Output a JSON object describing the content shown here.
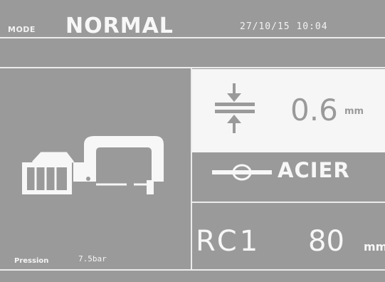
{
  "header": {
    "mode_label": "MODE",
    "mode_value": "NORMAL",
    "datetime": "27/10/15 10:04"
  },
  "thickness": {
    "icon": "sheet-thickness-icon",
    "value": "0.6",
    "unit": "mm"
  },
  "material": {
    "icon": "sheet-material-icon",
    "name": "ACIER"
  },
  "arm": {
    "label": "RC1",
    "value": "80",
    "unit": "mm"
  },
  "pression": {
    "label": "Pression",
    "value": "7.5bar"
  },
  "gun": {
    "icon": "c-gun-icon"
  },
  "colors": {
    "background": "#9a9a9a",
    "foreground": "#f4f4f4",
    "panel": "#f6f6f6"
  }
}
